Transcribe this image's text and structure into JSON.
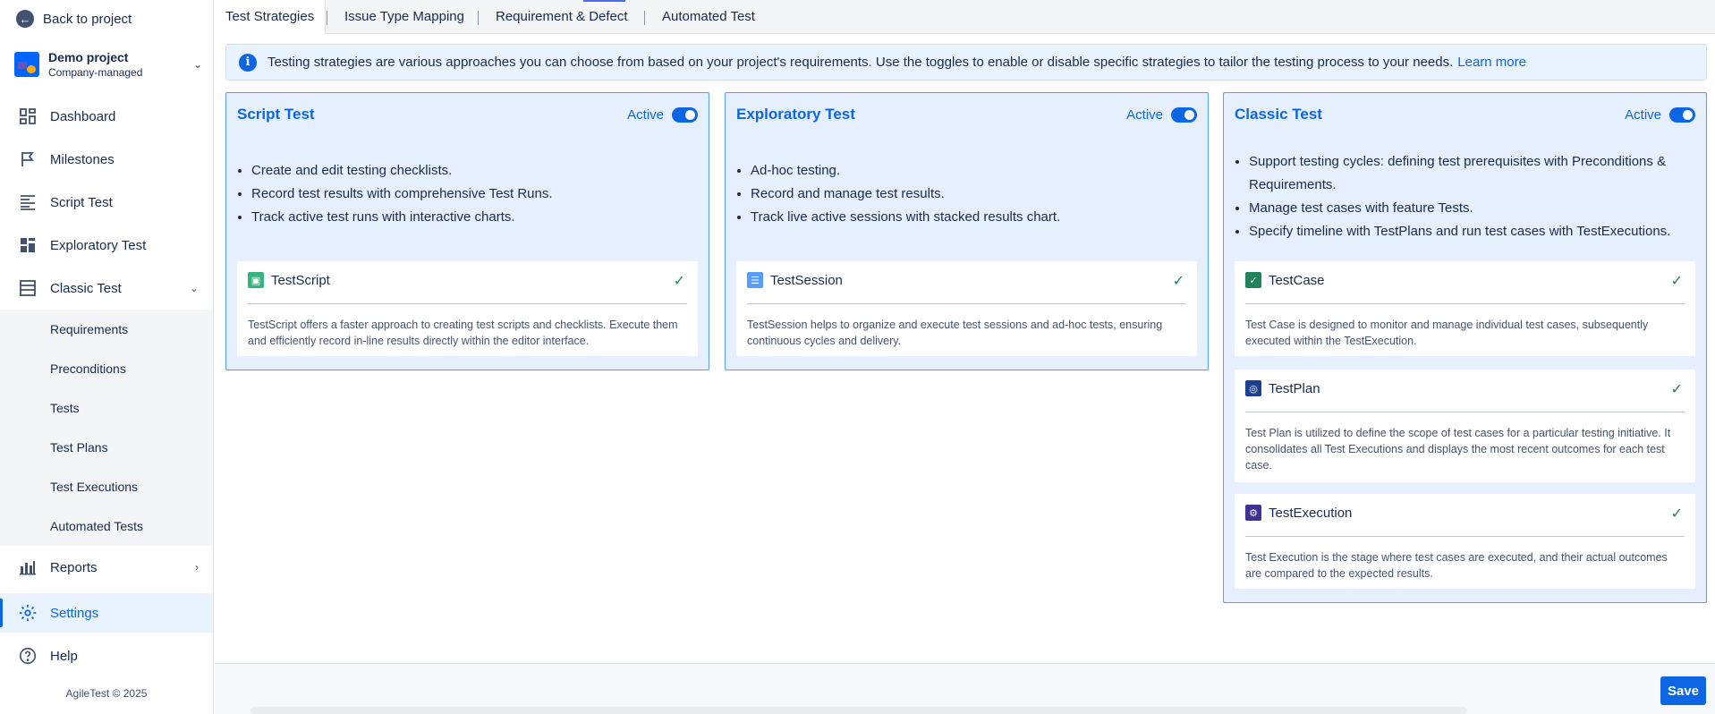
{
  "sidebar": {
    "back_label": "Back to project",
    "project": {
      "name": "Demo project",
      "type": "Company-managed"
    },
    "items": [
      {
        "label": "Dashboard",
        "icon": "dashboard-icon"
      },
      {
        "label": "Milestones",
        "icon": "flag-icon"
      },
      {
        "label": "Script Test",
        "icon": "list-icon"
      },
      {
        "label": "Exploratory Test",
        "icon": "grid-icon"
      },
      {
        "label": "Classic Test",
        "icon": "panel-icon"
      },
      {
        "label": "Reports",
        "icon": "bar-chart-icon"
      },
      {
        "label": "Settings",
        "icon": "gear-icon"
      },
      {
        "label": "Help",
        "icon": "help-icon"
      }
    ],
    "classic_sub_items": [
      "Requirements",
      "Preconditions",
      "Tests",
      "Test Plans",
      "Test Executions",
      "Automated Tests"
    ],
    "footer": "AgileTest © 2025"
  },
  "tabs": [
    "Test Strategies",
    "Issue Type Mapping",
    "Requirement & Defect",
    "Automated Test"
  ],
  "info": {
    "text": "Testing strategies are various approaches you can choose from based on your project's requirements. Use the toggles to enable or disable specific strategies to tailor the testing process to your needs.",
    "link": "Learn more"
  },
  "cards": [
    {
      "title": "Script Test",
      "status": "Active",
      "bullets": [
        "Create and edit testing checklists.",
        "Record test results with comprehensive Test Runs.",
        "Track active test runs with interactive charts."
      ],
      "features": [
        {
          "name": "TestScript",
          "desc": "TestScript offers a faster approach to creating test scripts and checklists. Execute them and efficiently record in-line results directly within the editor interface."
        }
      ]
    },
    {
      "title": "Exploratory Test",
      "status": "Active",
      "bullets": [
        "Ad-hoc testing.",
        "Record and manage test results.",
        "Track live active sessions with stacked results chart."
      ],
      "features": [
        {
          "name": "TestSession",
          "desc": "TestSession helps to organize and execute test sessions and ad-hoc tests, ensuring continuous cycles and delivery."
        }
      ]
    },
    {
      "title": "Classic Test",
      "status": "Active",
      "bullets": [
        "Support testing cycles: defining test prerequisites with Preconditions & Requirements.",
        "Manage test cases with feature Tests.",
        "Specify timeline with TestPlans and run test cases with TestExecutions."
      ],
      "features": [
        {
          "name": "TestCase",
          "desc": "Test Case is designed to monitor and manage individual test cases, subsequently executed within the TestExecution."
        },
        {
          "name": "TestPlan",
          "desc": "Test Plan is utilized to define the scope of test cases for a particular testing initiative. It consolidates all Test Executions and displays the most recent outcomes for each test case."
        },
        {
          "name": "TestExecution",
          "desc": "Test Execution is the stage where test cases are executed, and their actual outcomes are compared to the expected results."
        }
      ]
    }
  ],
  "footer_bar": {
    "save_label": "Save"
  },
  "colors": {
    "accent": "#0c66e4",
    "card_bg": "#e6effd",
    "card_border": "#579dff",
    "check": "#1f845a"
  }
}
